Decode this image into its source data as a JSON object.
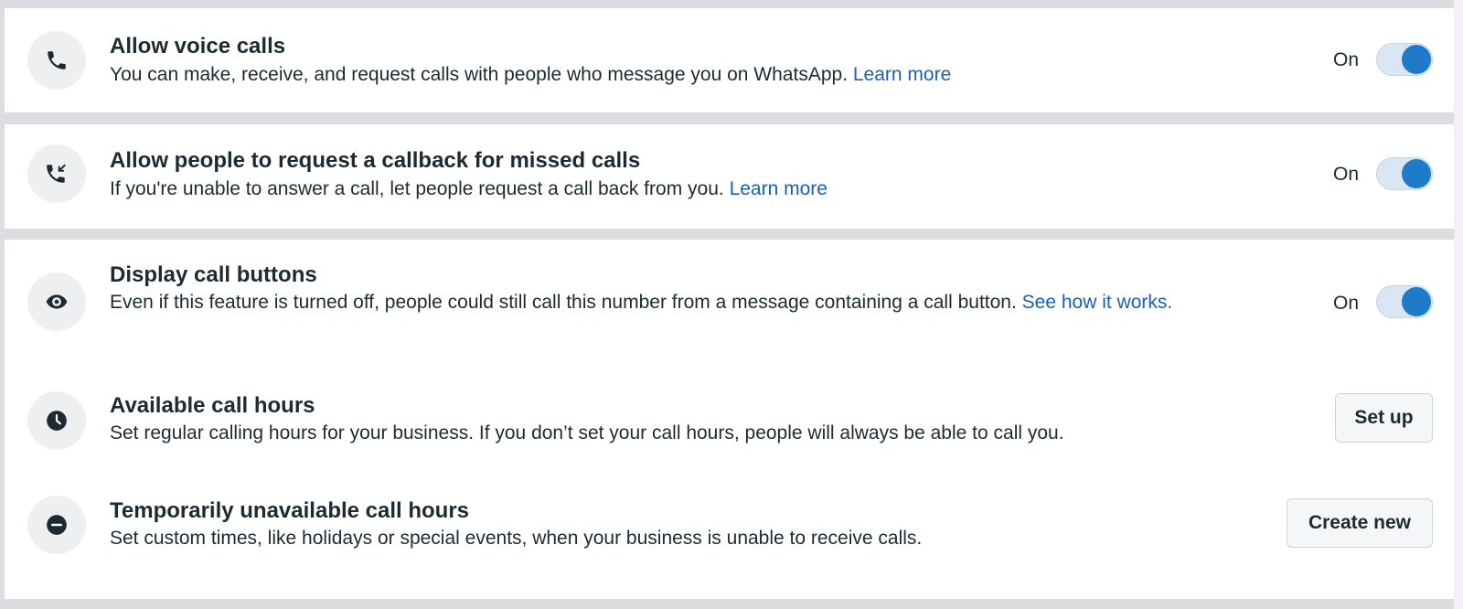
{
  "settings": [
    {
      "title": "Allow voice calls",
      "description": "You can make, receive, and request calls with people who message you on WhatsApp.",
      "link": "Learn more",
      "toggle_label": "On",
      "enabled": true,
      "icon": "phone-icon"
    },
    {
      "title": "Allow people to request a callback for missed calls",
      "description": "If you're unable to answer a call, let people request a call back from you.",
      "link": "Learn more",
      "toggle_label": "On",
      "enabled": true,
      "icon": "missed-call-icon"
    },
    {
      "title": "Display call buttons",
      "description": "Even if this feature is turned off, people could still call this number from a message containing a call button.",
      "link": "See how it works.",
      "toggle_label": "On",
      "enabled": true,
      "icon": "eye-icon"
    },
    {
      "title": "Available call hours",
      "description": "Set regular calling hours for your business. If you don’t set your call hours, people will always be able to call you.",
      "button": "Set up",
      "icon": "clock-icon"
    },
    {
      "title": "Temporarily unavailable call hours",
      "description": "Set custom times, like holidays or special events, when your business is unable to receive calls.",
      "button": "Create new",
      "icon": "minus-circle-icon"
    }
  ],
  "colors": {
    "accent": "#1f7bc8",
    "link": "#1a5fb4",
    "text": "#1c2b33",
    "background": "#dcdde1"
  }
}
